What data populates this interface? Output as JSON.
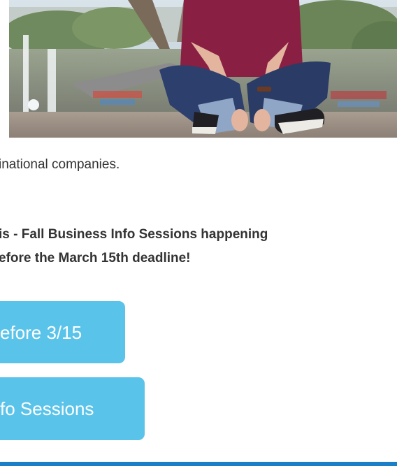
{
  "hero": {
    "image": "woman-sitting-cross-legged-eiffel-tower-photo"
  },
  "body": {
    "line1": "inational companies.",
    "line2": "is - Fall Business Info Sessions happening",
    "line3": "efore the March 15th deadline!"
  },
  "buttons": {
    "apply_label": "efore 3/15",
    "sessions_label": "fo Sessions"
  },
  "colors": {
    "button_bg": "#5ac3ea",
    "button_text": "#ffffff",
    "bottom_bar": "#1a7fc6",
    "text": "#333333"
  }
}
